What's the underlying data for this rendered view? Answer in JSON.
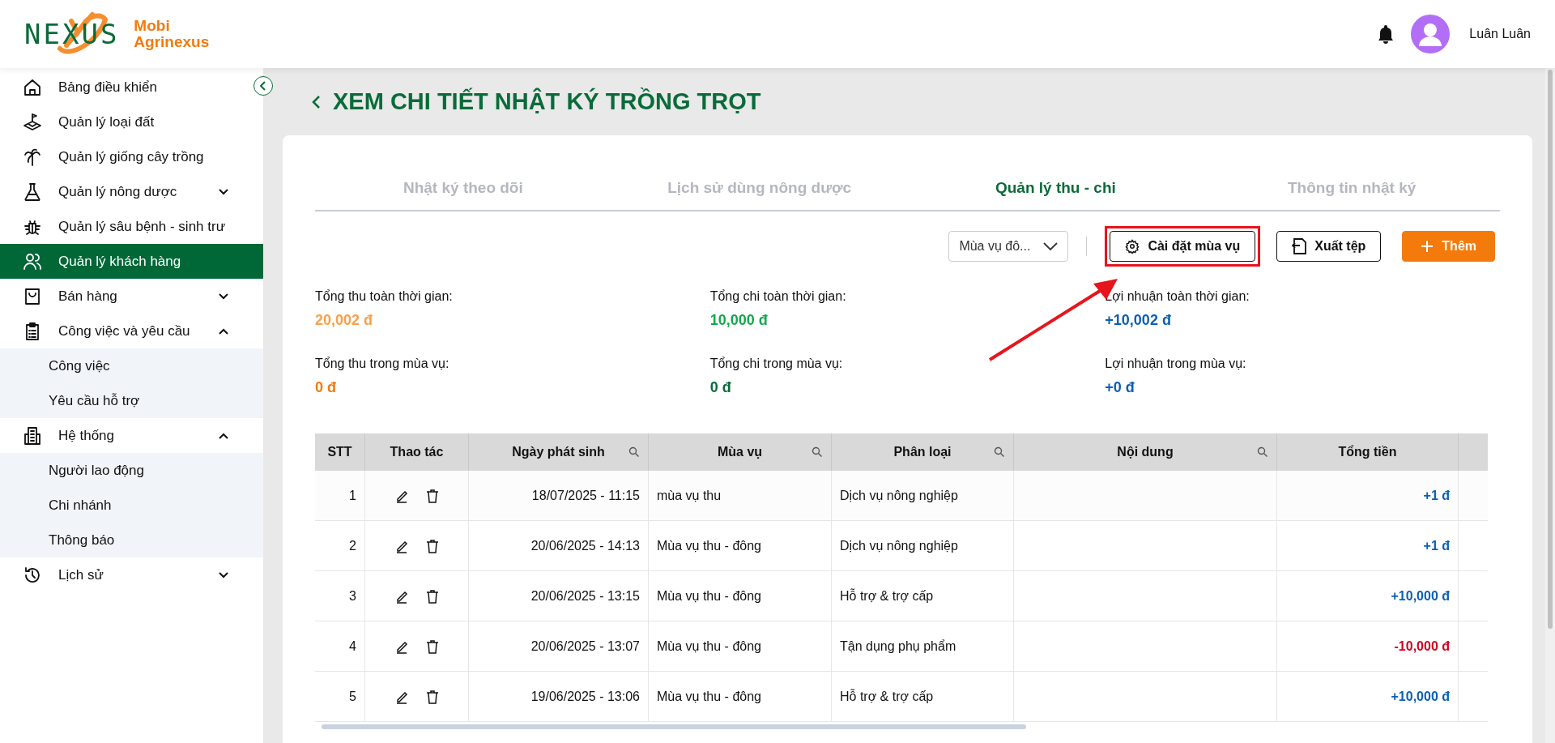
{
  "header": {
    "logo_text": "NEXUS",
    "brand": [
      "Mobi",
      "Agrinexus"
    ],
    "user_name": "Luân Luân"
  },
  "sidebar": {
    "items": [
      {
        "label": "Bảng điều khiển",
        "selected": false
      },
      {
        "label": "Quản lý loại đất",
        "selected": false
      },
      {
        "label": "Quản lý giống cây trồng",
        "selected": false
      },
      {
        "label": "Quản lý nông dược",
        "selected": false,
        "expanded": false
      },
      {
        "label": "Quản lý sâu bệnh - sinh trư",
        "selected": false
      },
      {
        "label": "Quản lý khách hàng",
        "selected": true
      },
      {
        "label": "Bán hàng",
        "selected": false,
        "expanded": false
      },
      {
        "label": "Công việc và yêu cầu",
        "selected": false,
        "expanded": true,
        "children": [
          {
            "label": "Công việc",
            "selected": false
          },
          {
            "label": "Yêu cầu hỗ trợ",
            "selected": false
          }
        ]
      },
      {
        "label": "Hệ thống",
        "selected": false,
        "expanded": true,
        "children": [
          {
            "label": "Người lao động",
            "selected": false
          },
          {
            "label": "Chi nhánh",
            "selected": false
          },
          {
            "label": "Thông báo",
            "selected": false
          }
        ]
      },
      {
        "label": "Lịch sử",
        "selected": false,
        "expanded": false
      }
    ]
  },
  "page_title": "XEM CHI TIẾT NHẬT KÝ TRỒNG TRỌT",
  "tabs": [
    {
      "label": "Nhật ký theo dõi",
      "selected": false
    },
    {
      "label": "Lịch sử dùng nông dược",
      "selected": false
    },
    {
      "label": "Quản lý thu - chi",
      "selected": true
    },
    {
      "label": "Thông tin nhật ký",
      "selected": false
    }
  ],
  "toolbar": {
    "season_filter": "Mùa vụ đô...",
    "buttons": [
      {
        "kind": "settings",
        "label": "Cài đặt mùa vụ",
        "highlighted": true
      },
      {
        "kind": "export",
        "label": "Xuất tệp",
        "highlighted": false
      },
      {
        "kind": "add",
        "label": "Thêm",
        "highlighted": false
      }
    ]
  },
  "stats": [
    {
      "label": "Tổng thu toàn thời gian:",
      "value": "20,002 đ",
      "color": "#f7a04b"
    },
    {
      "label": "Tổng chi toàn thời gian:",
      "value": "10,000 đ",
      "color": "#13a84d"
    },
    {
      "label": "Lợi nhuận toàn thời gian:",
      "value": "+10,002 đ",
      "color": "#0b5fb4"
    },
    {
      "label": "Tổng thu trong mùa vụ:",
      "value": "0 đ",
      "color": "#f47b0b"
    },
    {
      "label": "Tổng chi trong mùa vụ:",
      "value": "0 đ",
      "color": "#0a6b3a"
    },
    {
      "label": "Lợi nhuận trong mùa vụ:",
      "value": "+0 đ",
      "color": "#0b5fb4"
    }
  ],
  "table": {
    "columns": [
      {
        "label": "STT",
        "searchable": false
      },
      {
        "label": "Thao tác",
        "searchable": false
      },
      {
        "label": "Ngày phát sinh",
        "searchable": true
      },
      {
        "label": "Mùa vụ",
        "searchable": true
      },
      {
        "label": "Phân loại",
        "searchable": true
      },
      {
        "label": "Nội dung",
        "searchable": true
      },
      {
        "label": "Tổng tiền",
        "searchable": false
      }
    ],
    "rows": [
      {
        "stt": "1",
        "date": "18/07/2025 - 11:15",
        "season": "mùa vụ thu",
        "category": "Dịch vụ nông nghiệp",
        "amount": "+1 đ",
        "kind": "income"
      },
      {
        "stt": "2",
        "date": "20/06/2025 - 14:13",
        "season": "Mùa vụ thu - đông",
        "category": "Dịch vụ nông nghiệp",
        "amount": "+1 đ",
        "kind": "income"
      },
      {
        "stt": "3",
        "date": "20/06/2025 - 13:15",
        "season": "Mùa vụ thu - đông",
        "category": "Hỗ trợ & trợ cấp",
        "amount": "+10,000 đ",
        "kind": "income"
      },
      {
        "stt": "4",
        "date": "20/06/2025 - 13:07",
        "season": "Mùa vụ thu - đông",
        "category": "Tận dụng phụ phẩm",
        "amount": "-10,000 đ",
        "kind": "expense"
      },
      {
        "stt": "5",
        "date": "19/06/2025 - 13:06",
        "season": "Mùa vụ thu - đông",
        "category": "Hỗ trợ & trợ cấp",
        "amount": "+10,000 đ",
        "kind": "income"
      }
    ]
  }
}
